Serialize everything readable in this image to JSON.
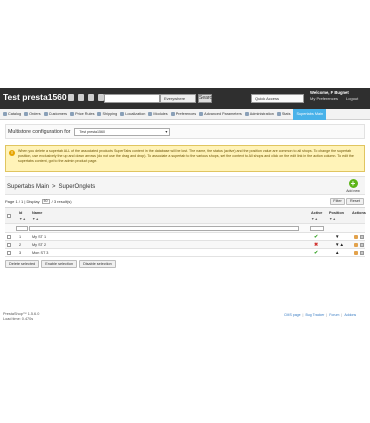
{
  "header": {
    "shop_name": "Test presta1560",
    "search_placeholder": "",
    "search_scope": "Everywhere",
    "search_button": "Search",
    "quick_access": "Quick Access",
    "welcome": "Welcome, F Bugnet",
    "my_preferences": "My Preferences",
    "logout": "Logout"
  },
  "menu": {
    "items": [
      {
        "label": "Catalog"
      },
      {
        "label": "Orders"
      },
      {
        "label": "Customers"
      },
      {
        "label": "Price Rules"
      },
      {
        "label": "Shipping"
      },
      {
        "label": "Localization"
      },
      {
        "label": "Modules"
      },
      {
        "label": "Preferences"
      },
      {
        "label": "Advanced Parameters"
      },
      {
        "label": "Administration"
      },
      {
        "label": "Stats"
      },
      {
        "label": "Supertabs Main"
      }
    ]
  },
  "multistore": {
    "label": "Multistore configuration for",
    "selected": "Test presta1560"
  },
  "warning": {
    "text": "When you delete a supertab ALL of the associated products SuperTabs content in the database will be lost. The name, the status (active) and the position value are common to all shops. To change the supertab position, use exclusively the up and down arrows (do not use the drag and drop). To associate a supertab to the various shops, set the context to All shops and click on the edit link in the action column. To edit the supertabs content, got to the admin product page."
  },
  "page": {
    "breadcrumb_1": "Supertabs Main",
    "breadcrumb_sep": ">",
    "breadcrumb_2": "SuperOnglets",
    "add_new": "Add new"
  },
  "list": {
    "pagination_prefix": "Page 1 / 1 | Display",
    "per_page": "50",
    "pagination_suffix": "/ 3 result(s)",
    "filter_button": "Filter",
    "reset_button": "Reset",
    "columns": {
      "id": "Id",
      "name": "Name",
      "active": "Active",
      "position": "Position",
      "actions": "Actions"
    },
    "sort_arrows": "▼▲",
    "rows": [
      {
        "id": "1",
        "name": "My ST 1",
        "active": "✔",
        "position": "▼"
      },
      {
        "id": "2",
        "name": "My ST 2",
        "active": "✖",
        "position": "▼▲"
      },
      {
        "id": "3",
        "name": "Mon ST 3",
        "active": "✔",
        "position": "▲"
      }
    ],
    "bulk": {
      "delete": "Delete selected",
      "enable": "Enable selection",
      "disable": "Disable selection"
    }
  },
  "footer": {
    "version": "PrestaShop™ 1.5.6.0",
    "load_time": "Load time: 0.470s",
    "links": [
      "Contact",
      "Bug Tracker",
      "Forum",
      "Addons"
    ],
    "link_prefix": "CMS page"
  },
  "colors": {
    "header_bg": "#2f2f2f",
    "active_tab": "#49b2e9",
    "warning_bg": "#fff3b8",
    "add_green": "#5cb518",
    "active_ok": "#3aa52a",
    "active_no": "#d0312d"
  }
}
